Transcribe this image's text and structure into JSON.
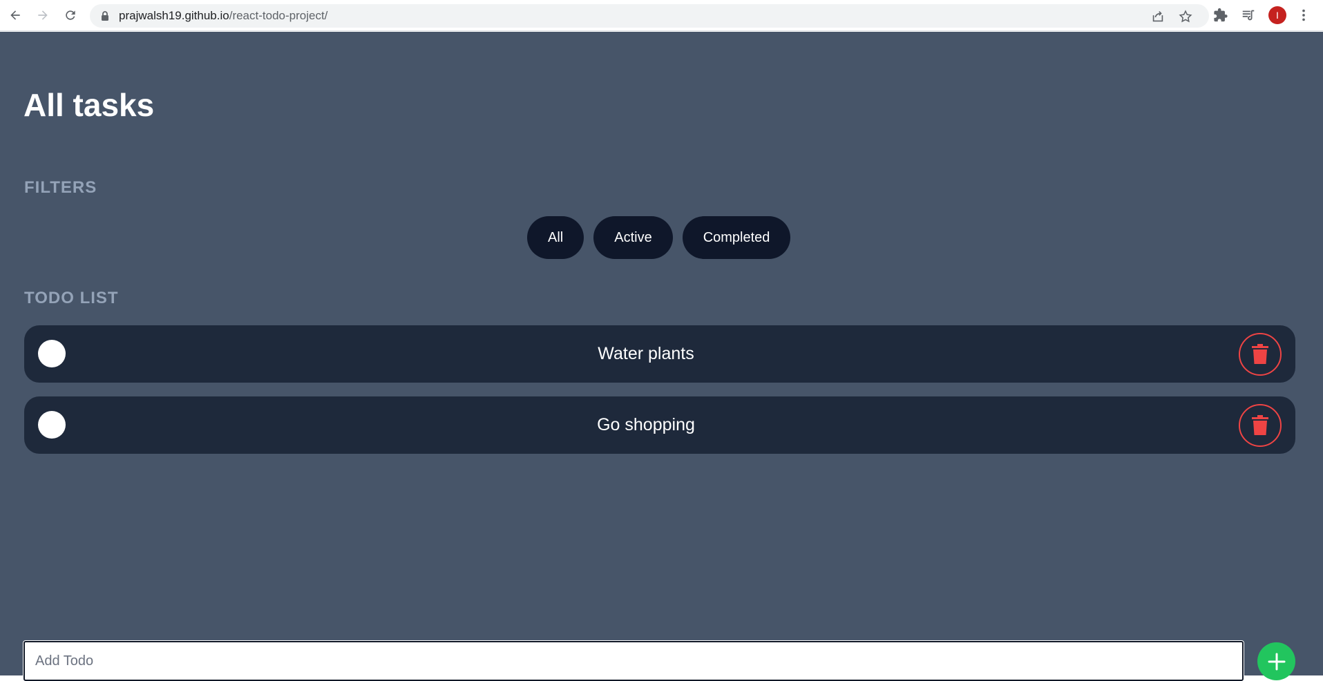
{
  "browser": {
    "url_host": "prajwalsh19.github.io",
    "url_path": "/react-todo-project/",
    "avatar_letter": "I",
    "icons": [
      "back-icon",
      "forward-icon",
      "reload-icon",
      "lock-icon",
      "share-icon",
      "star-icon",
      "extensions-icon",
      "reading-list-icon",
      "more-menu-icon"
    ]
  },
  "page": {
    "title": "All tasks"
  },
  "filters": {
    "heading": "FILTERS",
    "buttons": [
      {
        "label": "All"
      },
      {
        "label": "Active"
      },
      {
        "label": "Completed"
      }
    ]
  },
  "todo_list": {
    "heading": "TODO LIST",
    "items": [
      {
        "text": "Water plants",
        "completed": false
      },
      {
        "text": "Go shopping",
        "completed": false
      }
    ]
  },
  "add_todo": {
    "placeholder": "Add Todo",
    "value": ""
  },
  "colors": {
    "background": "#475569",
    "card": "#1e293b",
    "filter_button": "#0f172a",
    "heading_muted": "#94a3b8",
    "delete": "#ef4444",
    "add": "#22c55e"
  }
}
